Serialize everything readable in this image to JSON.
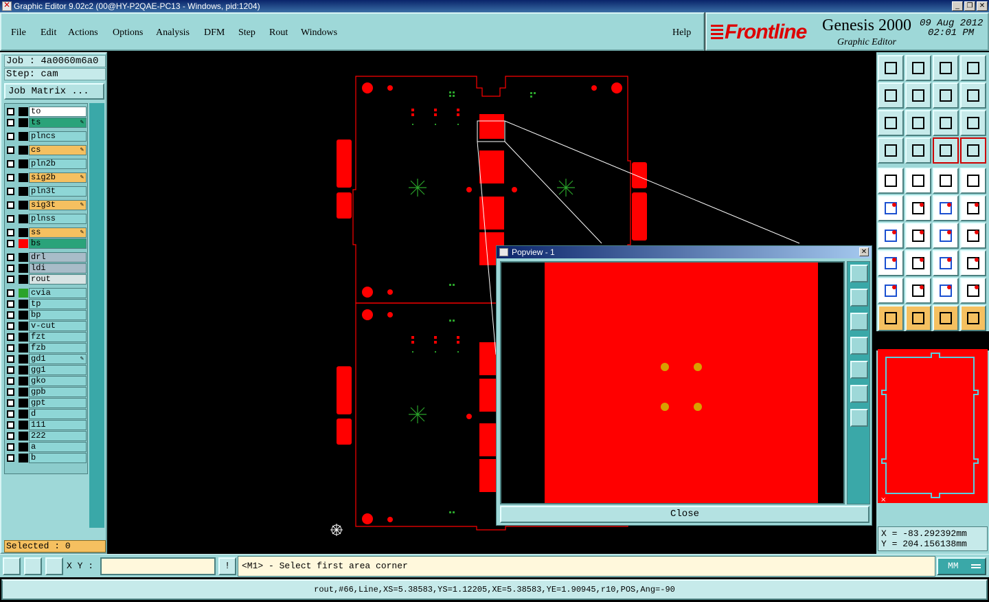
{
  "window": {
    "title": "Graphic Editor 9.02c2 (00@HY-P2QAE-PC13 - Windows, pid:1204)",
    "minimize": "_",
    "restore": "❐",
    "close": "✕"
  },
  "menu": {
    "items": [
      "File",
      "Edit",
      "Actions",
      "Options",
      "Analysis",
      "DFM",
      "Step",
      "Rout",
      "Windows"
    ],
    "help": "Help"
  },
  "brand": {
    "logo": "Frontline",
    "product": "Genesis 2000",
    "subtitle": "Graphic Editor",
    "date": "09 Aug 2012",
    "time": "02:01 PM"
  },
  "job": {
    "job_label": "Job : 4a0060m6a0",
    "step_label": "Step: cam",
    "matrix_button": "Job Matrix ..."
  },
  "layers": [
    {
      "name": "to",
      "color": "#ffffff",
      "swatch": "#000000",
      "edit": false
    },
    {
      "name": "ts",
      "color": "#2aa37a",
      "swatch": "#000000",
      "edit": true
    },
    {
      "name": "plncs",
      "color": "#8ed6d6",
      "swatch": "#000000",
      "edit": false
    },
    {
      "name": "cs",
      "color": "#f5c060",
      "swatch": "#000000",
      "edit": true
    },
    {
      "name": "pln2b",
      "color": "#8ed6d6",
      "swatch": "#000000",
      "edit": false
    },
    {
      "name": "sig2b",
      "color": "#f5c060",
      "swatch": "#000000",
      "edit": true
    },
    {
      "name": "pln3t",
      "color": "#8ed6d6",
      "swatch": "#000000",
      "edit": false
    },
    {
      "name": "sig3t",
      "color": "#f5c060",
      "swatch": "#000000",
      "edit": true
    },
    {
      "name": "plnss",
      "color": "#8ed6d6",
      "swatch": "#000000",
      "edit": false
    },
    {
      "name": "ss",
      "color": "#f5c060",
      "swatch": "#000000",
      "edit": true
    },
    {
      "name": "bs",
      "color": "#2aa37a",
      "swatch": "#ff0000",
      "edit": false
    },
    {
      "name": "drl",
      "color": "#a8bcc8",
      "swatch": "#000000",
      "edit": false
    },
    {
      "name": "ldi",
      "color": "#a8bcc8",
      "swatch": "#000000",
      "edit": false
    },
    {
      "name": "rout",
      "color": "#d8e4e4",
      "swatch": "#000000",
      "edit": false
    },
    {
      "name": "cvia",
      "color": "#8ed6d6",
      "swatch": "#2aa32a",
      "edit": false
    },
    {
      "name": "tp",
      "color": "#8ed6d6",
      "swatch": "#000000",
      "edit": false
    },
    {
      "name": "bp",
      "color": "#8ed6d6",
      "swatch": "#000000",
      "edit": false
    },
    {
      "name": "v-cut",
      "color": "#8ed6d6",
      "swatch": "#000000",
      "edit": false
    },
    {
      "name": "fzt",
      "color": "#8ed6d6",
      "swatch": "#000000",
      "edit": false
    },
    {
      "name": "fzb",
      "color": "#8ed6d6",
      "swatch": "#000000",
      "edit": false
    },
    {
      "name": "gd1",
      "color": "#8ed6d6",
      "swatch": "#000000",
      "edit": true
    },
    {
      "name": "gg1",
      "color": "#8ed6d6",
      "swatch": "#000000",
      "edit": false
    },
    {
      "name": "gko",
      "color": "#8ed6d6",
      "swatch": "#000000",
      "edit": false
    },
    {
      "name": "gpb",
      "color": "#8ed6d6",
      "swatch": "#000000",
      "edit": false
    },
    {
      "name": "gpt",
      "color": "#8ed6d6",
      "swatch": "#000000",
      "edit": false
    },
    {
      "name": "d",
      "color": "#8ed6d6",
      "swatch": "#000000",
      "edit": false
    },
    {
      "name": "111",
      "color": "#8ed6d6",
      "swatch": "#000000",
      "edit": false
    },
    {
      "name": "222",
      "color": "#8ed6d6",
      "swatch": "#000000",
      "edit": false
    },
    {
      "name": "a",
      "color": "#8ed6d6",
      "swatch": "#000000",
      "edit": false
    },
    {
      "name": "b",
      "color": "#8ed6d6",
      "swatch": "#000000",
      "edit": false
    }
  ],
  "selected": "Selected : 0",
  "popview": {
    "title": "Popview - 1",
    "close_button": "Close"
  },
  "coords": {
    "x": "X = -83.292392mm",
    "y": "Y = 204.156138mm"
  },
  "command": {
    "xy_label": "X Y :",
    "xy_value": "",
    "prompt": "<M1> - Select first area corner",
    "units": "MM"
  },
  "status": "rout,#66,Line,XS=5.38583,YS=1.12205,XE=5.38583,YE=1.90945,r10,POS,Ang=-90",
  "colors": {
    "panel": "#9ed8d8",
    "copper": "#ff0000",
    "accent": "#f5c060"
  }
}
